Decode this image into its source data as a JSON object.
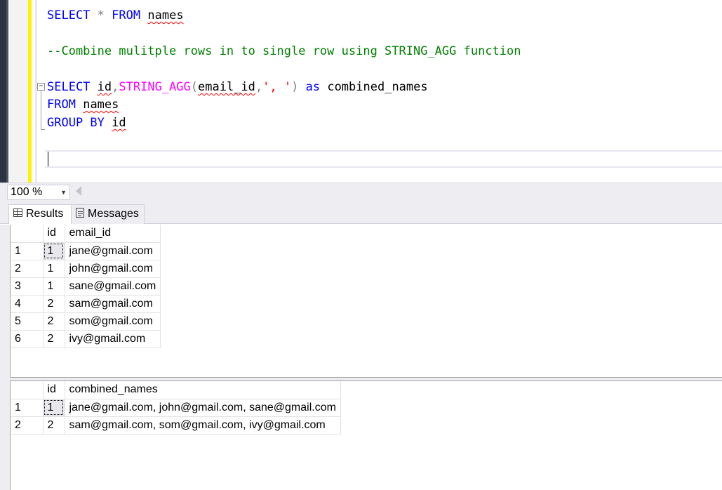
{
  "editor": {
    "lines": [
      [
        {
          "text": "SELECT",
          "cls": "kw"
        },
        {
          "text": " ",
          "cls": ""
        },
        {
          "text": "*",
          "cls": "op"
        },
        {
          "text": " ",
          "cls": ""
        },
        {
          "text": "FROM",
          "cls": "kw"
        },
        {
          "text": " ",
          "cls": ""
        },
        {
          "text": "names",
          "cls": "squig"
        }
      ],
      [],
      [
        {
          "text": "--Combine mulitple rows in to single row using STRING_AGG function",
          "cls": "cmt"
        }
      ],
      [],
      [
        {
          "text": "SELECT",
          "cls": "kw"
        },
        {
          "text": " ",
          "cls": ""
        },
        {
          "text": "id",
          "cls": "squig"
        },
        {
          "text": ",",
          "cls": "op"
        },
        {
          "text": "STRING_AGG",
          "cls": "fn"
        },
        {
          "text": "(",
          "cls": "op"
        },
        {
          "text": "email_id",
          "cls": "squig"
        },
        {
          "text": ",",
          "cls": "op"
        },
        {
          "text": "', '",
          "cls": "str"
        },
        {
          "text": ")",
          "cls": "op"
        },
        {
          "text": " ",
          "cls": ""
        },
        {
          "text": "as",
          "cls": "kw"
        },
        {
          "text": " combined_names",
          "cls": ""
        }
      ],
      [
        {
          "text": "FROM",
          "cls": "kw"
        },
        {
          "text": " ",
          "cls": ""
        },
        {
          "text": "names",
          "cls": "squig"
        }
      ],
      [
        {
          "text": "GROUP BY",
          "cls": "kw"
        },
        {
          "text": " ",
          "cls": ""
        },
        {
          "text": "id",
          "cls": "squig"
        }
      ]
    ]
  },
  "zoom": {
    "value": "100 %",
    "arrow": "▼"
  },
  "tabs": {
    "results": "Results",
    "messages": "Messages"
  },
  "result1": {
    "columns": [
      "",
      "id",
      "email_id"
    ],
    "rows": [
      [
        "1",
        "1",
        "jane@gmail.com"
      ],
      [
        "2",
        "1",
        "john@gmail.com"
      ],
      [
        "3",
        "1",
        "sane@gmail.com"
      ],
      [
        "4",
        "2",
        "sam@gmail.com"
      ],
      [
        "5",
        "2",
        "som@gmail.com"
      ],
      [
        "6",
        "2",
        "ivy@gmail.com"
      ]
    ]
  },
  "result2": {
    "columns": [
      "",
      "id",
      "combined_names"
    ],
    "rows": [
      [
        "1",
        "1",
        "jane@gmail.com, john@gmail.com, sane@gmail.com"
      ],
      [
        "2",
        "2",
        "sam@gmail.com, som@gmail.com, ivy@gmail.com"
      ]
    ]
  }
}
